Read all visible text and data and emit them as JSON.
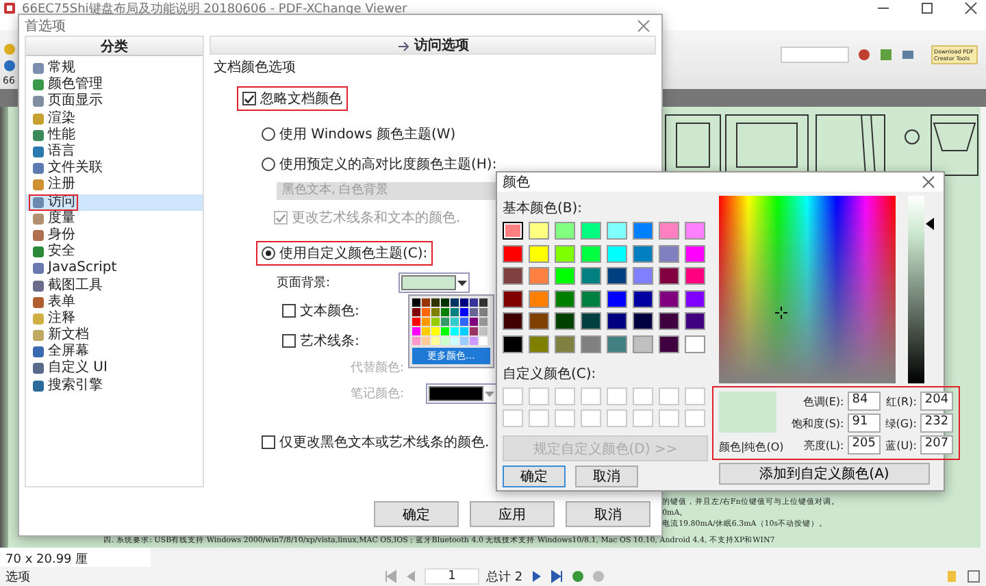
{
  "app": {
    "title": "66EC75Shi键盘布局及功能说明 20180606 - PDF-XChange Viewer",
    "zoom": "66",
    "download_button": "Download PDF Creator Tools",
    "document_lines": [
      "的键值，并且左/右Fn位键值可与上位键值对调。",
      "0mA。",
      "电流19.80mA/休眠6.3mA（10s不动按键）。"
    ],
    "document_footer": "四.  系统要求:    USB有线支持 Windows 2000/win7/8/10/xp/vista,linux,MAC OS,IOS ;    蓝牙Bluetooth 4.0 无线技术支持 Windows10/8.1, Mac OS 10.10, Android 4.4,    不支持XP和WIN7",
    "page_size": "70 x 20.99 厘",
    "options_button": "选项",
    "page_number": "1",
    "page_total": "总计 2"
  },
  "preferences": {
    "title": "首选项",
    "category_header": "分类",
    "categories": [
      {
        "label": "常规",
        "selected": false,
        "highlighted": false,
        "color": "#7a8fb0"
      },
      {
        "label": "颜色管理",
        "selected": false,
        "highlighted": false,
        "color": "#3a9a4a"
      },
      {
        "label": "页面显示",
        "selected": false,
        "highlighted": false,
        "color": "#8090a0"
      },
      {
        "label": "渲染",
        "selected": false,
        "highlighted": false,
        "color": "#c8a030"
      },
      {
        "label": "性能",
        "selected": false,
        "highlighted": false,
        "color": "#3a8a5a"
      },
      {
        "label": "语言",
        "selected": false,
        "highlighted": false,
        "color": "#2a7ab0"
      },
      {
        "label": "文件关联",
        "selected": false,
        "highlighted": false,
        "color": "#5a7ab0"
      },
      {
        "label": "注册",
        "selected": false,
        "highlighted": false,
        "color": "#d09030"
      },
      {
        "label": "访问",
        "selected": true,
        "highlighted": true,
        "color": "#6a8ab0"
      },
      {
        "label": "度量",
        "selected": false,
        "highlighted": false,
        "color": "#b09070"
      },
      {
        "label": "身份",
        "selected": false,
        "highlighted": false,
        "color": "#b07050"
      },
      {
        "label": "安全",
        "selected": false,
        "highlighted": false,
        "color": "#2a8a3a"
      },
      {
        "label": "JavaScript",
        "selected": false,
        "highlighted": false,
        "color": "#6a7ab0"
      },
      {
        "label": "截图工具",
        "selected": false,
        "highlighted": false,
        "color": "#6a6a8a"
      },
      {
        "label": "表单",
        "selected": false,
        "highlighted": false,
        "color": "#b06030"
      },
      {
        "label": "注释",
        "selected": false,
        "highlighted": false,
        "color": "#d0b040"
      },
      {
        "label": "新文档",
        "selected": false,
        "highlighted": false,
        "color": "#c0a860"
      },
      {
        "label": "全屏幕",
        "selected": false,
        "highlighted": false,
        "color": "#3a6ab0"
      },
      {
        "label": "自定义 UI",
        "selected": false,
        "highlighted": false,
        "color": "#5a6a8a"
      },
      {
        "label": "搜索引擎",
        "selected": false,
        "highlighted": false,
        "color": "#2a6a9a"
      }
    ],
    "panel_title": "访问选项",
    "group_title": "文档颜色选项",
    "ignore_colors": {
      "label": "忽略文档颜色",
      "checked": true,
      "highlighted": true
    },
    "themes": [
      {
        "label": "使用 Windows 颜色主题(W)",
        "selected": false,
        "highlighted": false
      },
      {
        "label": "使用预定义的高对比度颜色主题(H):",
        "selected": false,
        "highlighted": false
      },
      {
        "label": "使用自定义颜色主题(C):",
        "selected": true,
        "highlighted": true
      }
    ],
    "preset_dropdown": {
      "value": "黑色文本, 白色背景",
      "disabled": true
    },
    "change_art": {
      "label": "更改艺术线条和文本的颜色.",
      "checked": true,
      "disabled": true
    },
    "page_background": {
      "label": "页面背景:",
      "color": "#cce8cf"
    },
    "text_color": {
      "label": "文本颜色:",
      "checked": false
    },
    "art_lines": {
      "label": "艺术线条:",
      "checked": false
    },
    "replace_color": {
      "label": "代替颜色:",
      "disabled": true
    },
    "note_color": {
      "label": "笔记颜色:",
      "disabled": true,
      "color": "#000000"
    },
    "palette": {
      "more_button": "更多颜色...",
      "colors": [
        {
          "color": "#000000"
        },
        {
          "color": "#993300"
        },
        {
          "color": "#333300"
        },
        {
          "color": "#003300"
        },
        {
          "color": "#003366"
        },
        {
          "color": "#000080"
        },
        {
          "color": "#333399"
        },
        {
          "color": "#333333"
        },
        {
          "color": "#800000"
        },
        {
          "color": "#ff6600"
        },
        {
          "color": "#808000"
        },
        {
          "color": "#008000"
        },
        {
          "color": "#008080"
        },
        {
          "color": "#0000ff"
        },
        {
          "color": "#666699"
        },
        {
          "color": "#808080"
        },
        {
          "color": "#ff0000"
        },
        {
          "color": "#ff9900"
        },
        {
          "color": "#99cc00"
        },
        {
          "color": "#339966"
        },
        {
          "color": "#33cccc"
        },
        {
          "color": "#3366ff"
        },
        {
          "color": "#800080"
        },
        {
          "color": "#969696"
        },
        {
          "color": "#ff00ff"
        },
        {
          "color": "#ffcc00"
        },
        {
          "color": "#ffff00"
        },
        {
          "color": "#00ff00"
        },
        {
          "color": "#00ffff"
        },
        {
          "color": "#00ccff"
        },
        {
          "color": "#993366"
        },
        {
          "color": "#c0c0c0"
        },
        {
          "color": "#ff99cc"
        },
        {
          "color": "#ffcc99"
        },
        {
          "color": "#ffff99"
        },
        {
          "color": "#ccffcc"
        },
        {
          "color": "#ccffff"
        },
        {
          "color": "#99ccff"
        },
        {
          "color": "#cc99ff"
        },
        {
          "color": "#ffffff"
        }
      ]
    },
    "only_black": {
      "label": "仅更改黑色文本或艺术线条的颜色.",
      "checked": false
    },
    "buttons": [
      "确定",
      "应用",
      "取消"
    ]
  },
  "color_dialog": {
    "title": "颜色",
    "basic_label": "基本颜色(B):",
    "basic_colors": [
      {
        "color": "#ff8080",
        "selected": true
      },
      {
        "color": "#ffff80",
        "selected": false
      },
      {
        "color": "#80ff80",
        "selected": false
      },
      {
        "color": "#00ff80",
        "selected": false
      },
      {
        "color": "#80ffff",
        "selected": false
      },
      {
        "color": "#0080ff",
        "selected": false
      },
      {
        "color": "#ff80c0",
        "selected": false
      },
      {
        "color": "#ff80ff",
        "selected": false
      },
      {
        "color": "#ff0000",
        "selected": false
      },
      {
        "color": "#ffff00",
        "selected": false
      },
      {
        "color": "#80ff00",
        "selected": false
      },
      {
        "color": "#00ff40",
        "selected": false
      },
      {
        "color": "#00ffff",
        "selected": false
      },
      {
        "color": "#0080c0",
        "selected": false
      },
      {
        "color": "#8080c0",
        "selected": false
      },
      {
        "color": "#ff00ff",
        "selected": false
      },
      {
        "color": "#804040",
        "selected": false
      },
      {
        "color": "#ff8040",
        "selected": false
      },
      {
        "color": "#00ff00",
        "selected": false
      },
      {
        "color": "#008080",
        "selected": false
      },
      {
        "color": "#004080",
        "selected": false
      },
      {
        "color": "#8080ff",
        "selected": false
      },
      {
        "color": "#800040",
        "selected": false
      },
      {
        "color": "#ff0080",
        "selected": false
      },
      {
        "color": "#800000",
        "selected": false
      },
      {
        "color": "#ff8000",
        "selected": false
      },
      {
        "color": "#008000",
        "selected": false
      },
      {
        "color": "#008040",
        "selected": false
      },
      {
        "color": "#0000ff",
        "selected": false
      },
      {
        "color": "#0000a0",
        "selected": false
      },
      {
        "color": "#800080",
        "selected": false
      },
      {
        "color": "#8000ff",
        "selected": false
      },
      {
        "color": "#400000",
        "selected": false
      },
      {
        "color": "#804000",
        "selected": false
      },
      {
        "color": "#004000",
        "selected": false
      },
      {
        "color": "#004040",
        "selected": false
      },
      {
        "color": "#000080",
        "selected": false
      },
      {
        "color": "#000040",
        "selected": false
      },
      {
        "color": "#400040",
        "selected": false
      },
      {
        "color": "#400080",
        "selected": false
      },
      {
        "color": "#000000",
        "selected": false
      },
      {
        "color": "#808000",
        "selected": false
      },
      {
        "color": "#808040",
        "selected": false
      },
      {
        "color": "#808080",
        "selected": false
      },
      {
        "color": "#408080",
        "selected": false
      },
      {
        "color": "#c0c0c0",
        "selected": false
      },
      {
        "color": "#400040",
        "selected": false
      },
      {
        "color": "#ffffff",
        "selected": false
      }
    ],
    "custom_label": "自定义颜色(C):",
    "define_button": {
      "label": "规定自定义颜色(D) >>",
      "disabled": true
    },
    "ok_button": "确定",
    "cancel_button": "取消",
    "preview_label": "颜色|纯色(O)",
    "values_highlighted": true,
    "fields": [
      {
        "label": "色调(E):",
        "value": "84"
      },
      {
        "label": "红(R):",
        "value": "204"
      },
      {
        "label": "饱和度(S):",
        "value": "91"
      },
      {
        "label": "绿(G):",
        "value": "232"
      },
      {
        "label": "亮度(L):",
        "value": "205"
      },
      {
        "label": "蓝(U):",
        "value": "207"
      }
    ],
    "add_button": "添加到自定义颜色(A)"
  }
}
